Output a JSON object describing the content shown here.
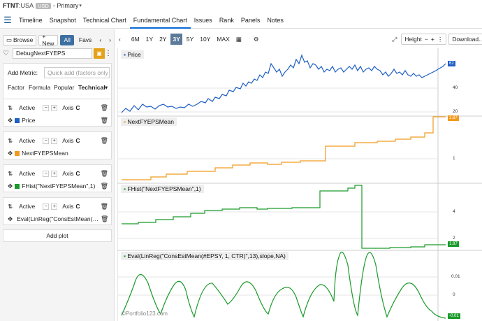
{
  "header": {
    "ticker": "FTNT",
    "exchange": ":USA",
    "currency": "USD",
    "label": "- Primary"
  },
  "nav": {
    "tabs": [
      "Timeline",
      "Snapshot",
      "Technical Chart",
      "Fundamental Chart",
      "Issues",
      "Rank",
      "Panels",
      "Notes"
    ],
    "active": "Fundamental Chart"
  },
  "left": {
    "browse": "Browse",
    "new": "+ New",
    "all": "All",
    "favs": "Favs",
    "dataset": "DebugNextFYEPS",
    "add_metric": "Add Metric:",
    "quick_add": "Quick add (factors only",
    "metric_tabs": [
      "Factor",
      "Formula",
      "Popular",
      "Technical"
    ],
    "plots": [
      {
        "active": "Active",
        "axis": "Axis",
        "axis_val": "C",
        "name": "Price",
        "color": "#1f5fc6"
      },
      {
        "active": "Active",
        "axis": "Axis",
        "axis_val": "C",
        "name": "NextFYEPSMean",
        "color": "#f29a1f"
      },
      {
        "active": "Active",
        "axis": "Axis",
        "axis_val": "C",
        "name": "FHist(\"NextFYEPSMean\",1)",
        "color": "#1a9a2a"
      },
      {
        "active": "Active",
        "axis": "Axis",
        "axis_val": "C",
        "name": "Eval(LinReg(\"ConsEstMean(…",
        "color": "#1a9a2a"
      }
    ],
    "add_plot": "Add plot"
  },
  "toolbar": {
    "ranges": [
      "6M",
      "1Y",
      "2Y",
      "3Y",
      "5Y",
      "10Y",
      "MAX"
    ],
    "active_range": "3Y",
    "height": "Height",
    "download": "Download..."
  },
  "chart": {
    "panels": [
      {
        "label": "Price",
        "bullet_color": "#1f5fc6",
        "ticks": [
          "40",
          "20"
        ],
        "tag": "62",
        "tag_color": "#1f5fc6"
      },
      {
        "label": "NextFYEPSMean",
        "bullet_color": "#f29a1f",
        "ticks": [
          "1"
        ],
        "tag": "1.87",
        "tag_color": "#f29a1f"
      },
      {
        "label": "FHist(\"NextFYEPSMean\",1)",
        "bullet_color": "#1a9a2a",
        "ticks": [
          "4",
          "2"
        ],
        "tag": "1.87",
        "tag_color": "#1a9a2a"
      },
      {
        "label": "Eval(LinReg(\"ConsEstMean(#EPSY, 1, CTR)\",13),slope,NA)",
        "bullet_color": "#1a9a2a",
        "ticks": [
          "0.01",
          "0"
        ],
        "tag": "-0.01",
        "tag_color": "#1a9a2a"
      }
    ],
    "copyright": "©Portfolio123.com"
  }
}
